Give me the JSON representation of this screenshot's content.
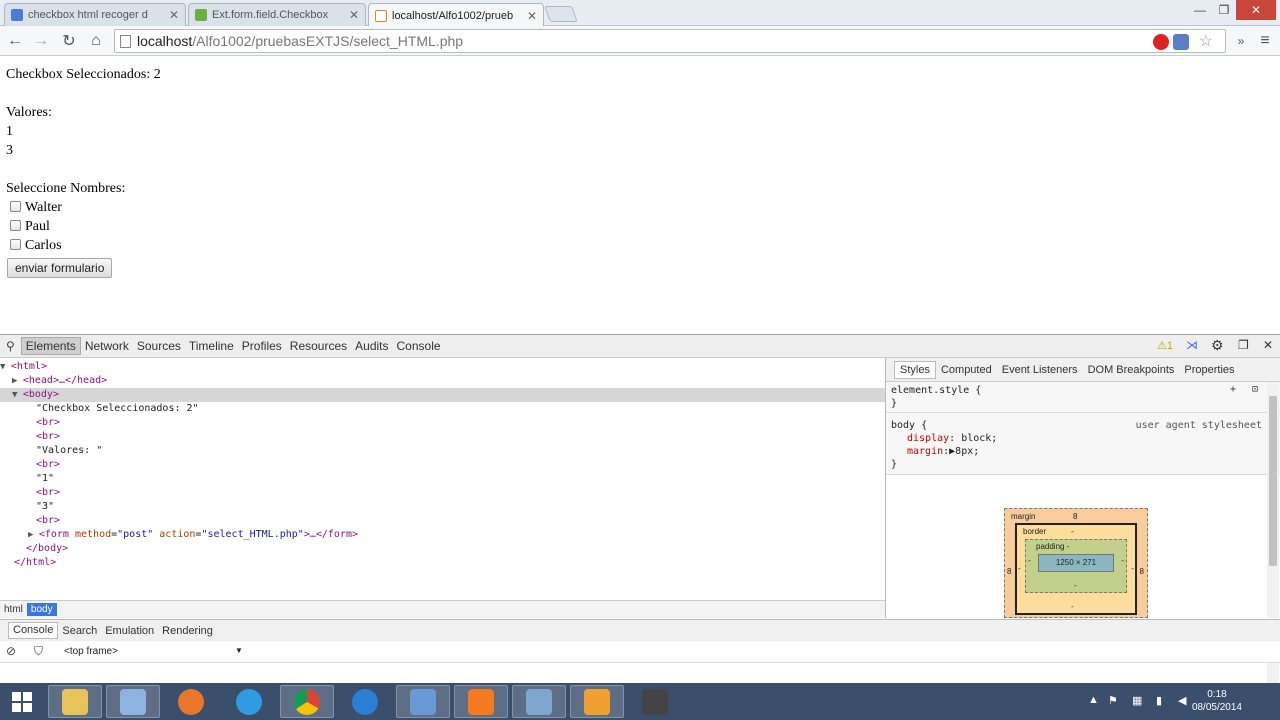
{
  "tabs": [
    {
      "title": "checkbox html recoger d",
      "icon": "google-icon",
      "active": false
    },
    {
      "title": "Ext.form.field.Checkbox",
      "icon": "extjs-icon",
      "active": false
    },
    {
      "title": "localhost/Alfo1002/prueb",
      "icon": "page-icon",
      "active": true
    }
  ],
  "address": {
    "host": "localhost",
    "path": "/Alfo1002/pruebasEXTJS/select_HTML.php"
  },
  "page": {
    "selected_count": "Checkbox Seleccionados: 2",
    "values_label": "Valores:",
    "values": [
      "1",
      "3"
    ],
    "select_names_label": "Seleccione Nombres:",
    "names": [
      "Walter",
      "Paul",
      "Carlos"
    ],
    "submit_label": "enviar formulario"
  },
  "devtools": {
    "panels": [
      "Elements",
      "Network",
      "Sources",
      "Timeline",
      "Profiles",
      "Resources",
      "Audits",
      "Console"
    ],
    "warning_count": "1",
    "dom": {
      "html_open": "<html>",
      "head": "<head>…</head>",
      "body_open": "<body>",
      "text_selected": "\"Checkbox Seleccionados: 2\"",
      "br": "<br>",
      "text_valores": "\"Valores: \"",
      "text_1": "\"1\"",
      "text_3": "\"3\"",
      "form_tag": "<form",
      "form_method_attr": "method",
      "form_method_val": "\"post\"",
      "form_action_attr": "action",
      "form_action_val": "\"select_HTML.php\"",
      "form_close": ">…</form>",
      "body_close": "</body>",
      "html_close": "</html>"
    },
    "breadcrumbs": [
      "html",
      "body"
    ],
    "sidebar_tabs": [
      "Styles",
      "Computed",
      "Event Listeners",
      "DOM Breakpoints",
      "Properties"
    ],
    "styles": {
      "element_style": "element.style {",
      "close_brace": "}",
      "body_rule": "body {",
      "ua_label": "user agent stylesheet",
      "prop_display": "display",
      "val_display": "block;",
      "prop_margin": "margin",
      "val_margin": "8px;"
    },
    "box_model": {
      "margin_label": "margin",
      "margin_value": "8",
      "border_label": "border",
      "border_value": "-",
      "padding_label": "padding -",
      "content": "1250 × 271",
      "dash": "-",
      "side_value": "8"
    },
    "drawer_tabs": [
      "Console",
      "Search",
      "Emulation",
      "Rendering"
    ],
    "frame_select": "<top frame>"
  },
  "taskbar": {
    "time": "0:18",
    "date": "08/05/2014"
  }
}
